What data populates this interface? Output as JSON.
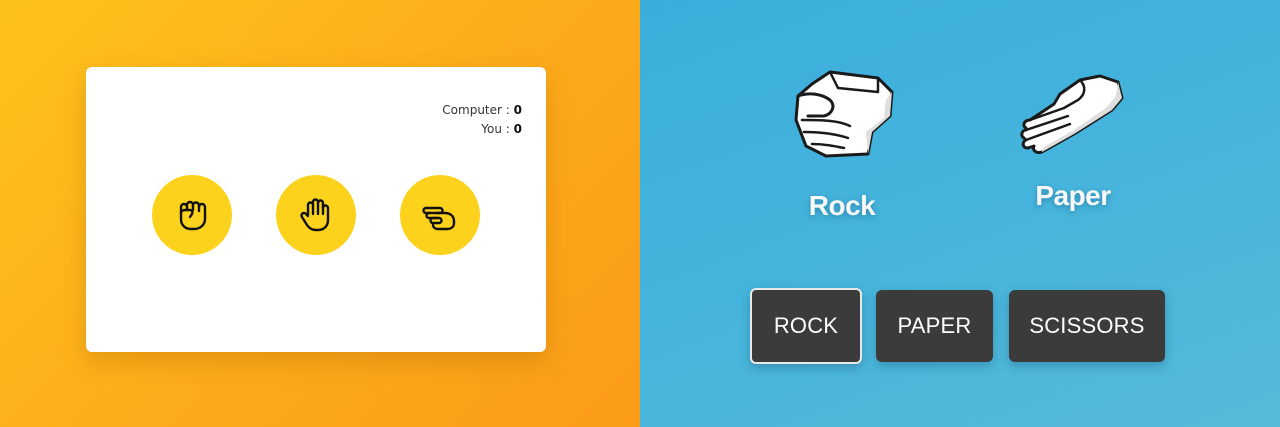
{
  "left_game": {
    "score": {
      "computer_label": "Computer :",
      "computer_value": "0",
      "you_label": "You :",
      "you_value": "0"
    },
    "choices": [
      {
        "icon": "rock-hand-icon"
      },
      {
        "icon": "paper-hand-icon"
      },
      {
        "icon": "scissors-hand-icon"
      }
    ],
    "colors": {
      "background_start": "#fdc31a",
      "background_end": "#fb9b18",
      "choice_circle": "#fcd21c"
    }
  },
  "right_game": {
    "player_hand": {
      "label": "Rock",
      "icon": "rock-fist-icon"
    },
    "computer_hand": {
      "label": "Paper",
      "icon": "paper-hand-icon"
    },
    "buttons": [
      {
        "label": "ROCK",
        "selected": true
      },
      {
        "label": "PAPER",
        "selected": false
      },
      {
        "label": "SCISSORS",
        "selected": false
      }
    ],
    "colors": {
      "background": "#45b4dc",
      "button": "#3b3b3b"
    }
  }
}
